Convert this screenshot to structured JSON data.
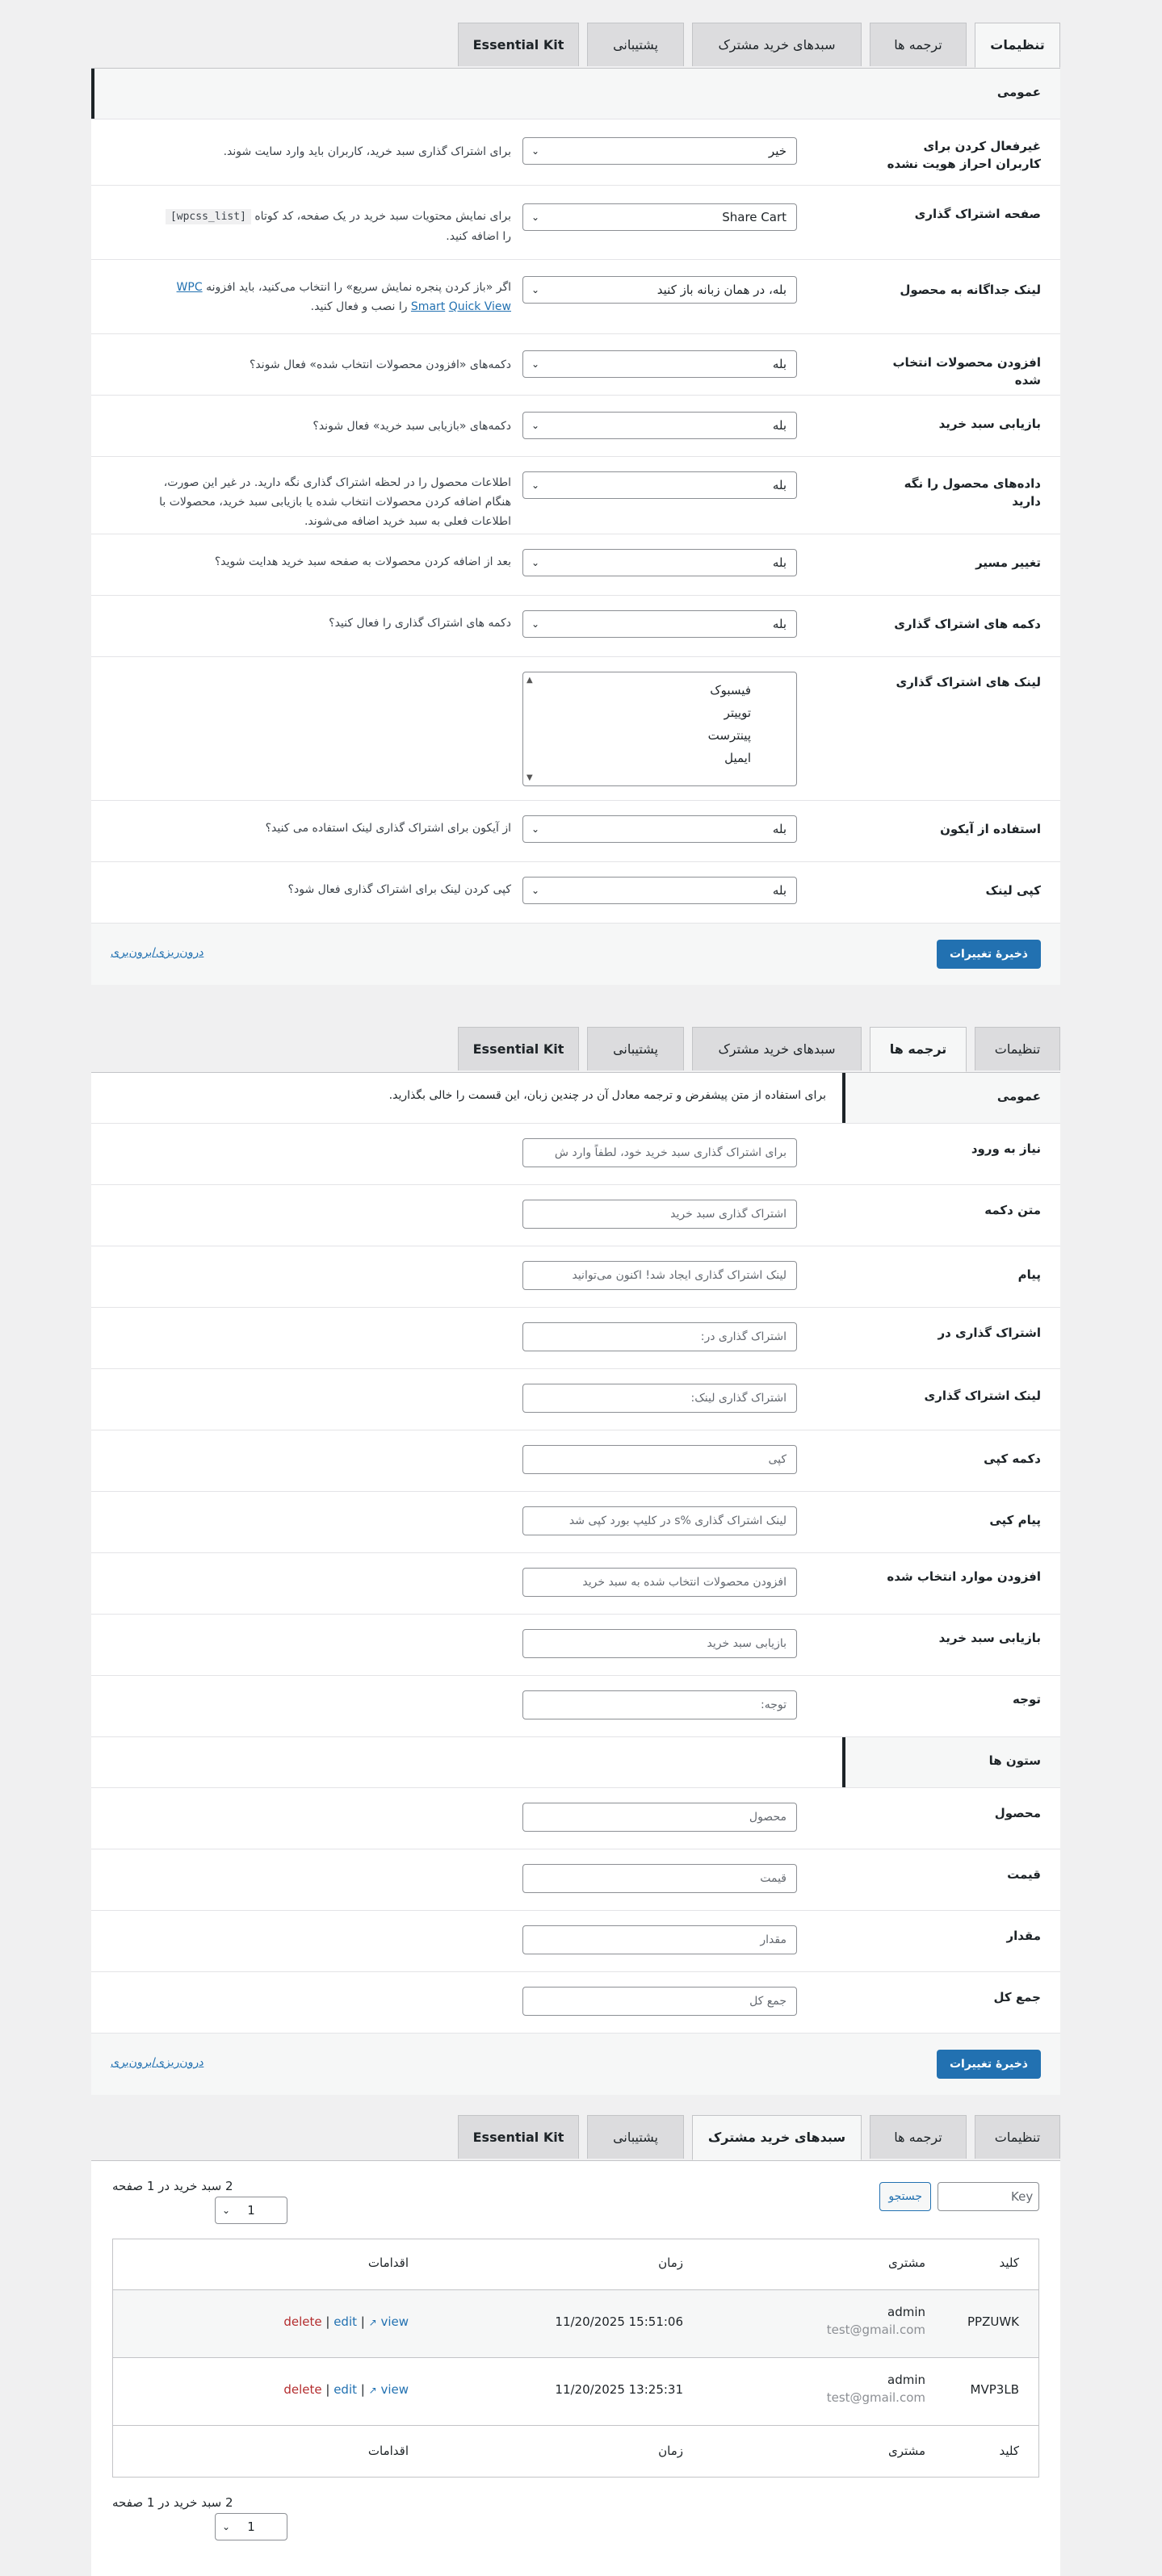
{
  "tabs": {
    "settings": "تنظیمات",
    "translations": "ترجمه ها",
    "shared_carts": "سبدهای خرید مشترک",
    "support": "پشتیبانی",
    "essential_kit": "Essential Kit"
  },
  "settings": {
    "section_general": "عمومی",
    "rows": [
      {
        "label": "غیرفعال کردن برای کاربران احراز هویت نشده",
        "value": "خیر",
        "desc": "برای اشتراک گذاری سبد خرید، کاربران باید وارد سایت شوند."
      },
      {
        "label": "صفحه اشتراک گذاری",
        "value": "Share Cart",
        "desc_pre": "برای نمایش محتویات سبد خرید در یک صفحه، کد کوتاه",
        "shortcode": "[wpcss_list]",
        "desc_post": "را اضافه کنید."
      },
      {
        "label": "لینک جداگانه به محصول",
        "value": "بله، در همان زبانه باز کنید",
        "desc_pre": "اگر «باز کردن پنجره نمایش سریع» را انتخاب می‌کنید، باید افزونه",
        "link1": "WPC Smart",
        "link2": "Quick View",
        "desc_post": "را نصب و فعال کنید."
      },
      {
        "label": "افزودن محصولات انتخاب شده",
        "value": "بله",
        "desc": "دکمه‌های «افزودن محصولات انتخاب شده» فعال شوند؟"
      },
      {
        "label": "بازیابی سبد خرید",
        "value": "بله",
        "desc": "دکمه‌های «بازیابی سبد خرید» فعال شوند؟"
      },
      {
        "label": "داده‌های محصول را نگه دارید",
        "value": "بله",
        "desc": "اطلاعات محصول را در لحظه اشتراک گذاری نگه دارید. در غیر این صورت، هنگام اضافه کردن محصولات انتخاب شده یا بازیابی سبد خرید، محصولات با اطلاعات فعلی به سبد خرید اضافه می‌شوند."
      },
      {
        "label": "تغییر مسیر",
        "value": "بله",
        "desc": "بعد از اضافه کردن محصولات به صفحه سبد خرید هدایت شوید؟"
      },
      {
        "label": "دکمه های اشتراک گذاری",
        "value": "بله",
        "desc": "دکمه های اشتراک گذاری را فعال کنید؟"
      }
    ],
    "share_links": {
      "label": "لینک های اشتراک گذاری",
      "options": [
        "فیسبوک",
        "توییتر",
        "پینترست",
        "ایمیل"
      ]
    },
    "rows2": [
      {
        "label": "استفاده از آیکون",
        "value": "بله",
        "desc": "از آیکون برای اشتراک گذاری لینک استفاده می کنید؟"
      },
      {
        "label": "کپی لینک",
        "value": "بله",
        "desc": "کپی کردن لینک برای اشتراک گذاری فعال شود؟"
      }
    ],
    "save": "ذخیرهٔ تغییرات",
    "import_export": "درون‌ریزی/برون‌بری"
  },
  "translations": {
    "section_general": "عمومی",
    "notice": "برای استفاده از متن پیشفرض و ترجمه معادل آن در چندین زبان، این قسمت را خالی بگذارید.",
    "rows": [
      {
        "label": "نیاز به ورود",
        "placeholder": "برای اشتراک گذاری سبد خرید خود، لطفاً وارد ش"
      },
      {
        "label": "متن دکمه",
        "placeholder": "اشتراک گذاری سبد خرید"
      },
      {
        "label": "پیام",
        "placeholder": "لینک اشتراک گذاری ایجاد شد! اکنون می‌توانید"
      },
      {
        "label": "اشتراک گذاری در",
        "placeholder": "اشتراک گذاری در:"
      },
      {
        "label": "لینک اشتراک گذاری",
        "placeholder": "اشتراک گذاری لینک:"
      },
      {
        "label": "دکمه کپی",
        "placeholder": "کپی"
      },
      {
        "label": "پیام کپی",
        "placeholder": "لینک اشتراک گذاری %s در کلیپ بورد کپی شد"
      },
      {
        "label": "افزودن موارد انتخاب شده",
        "placeholder": "افزودن محصولات انتخاب شده به سبد خرید"
      },
      {
        "label": "بازیابی سبد خرید",
        "placeholder": "بازیابی سبد خرید"
      },
      {
        "label": "توجه",
        "placeholder": "توجه:"
      }
    ],
    "section_columns": "ستون ها",
    "cols": [
      {
        "label": "محصول",
        "placeholder": "محصول"
      },
      {
        "label": "قیمت",
        "placeholder": "قیمت"
      },
      {
        "label": "مقدار",
        "placeholder": "مقدار"
      },
      {
        "label": "جمع کل",
        "placeholder": "جمع کل"
      }
    ],
    "save": "ذخیرهٔ تغییرات",
    "import_export": "درون‌ریزی/برون‌بری"
  },
  "shared": {
    "search_placeholder": "Key",
    "search_button": "جستجو",
    "pager_text": "2 سبد خرید در 1 صفحه",
    "page_value": "1",
    "headers": {
      "key": "کلید",
      "customer": "مشتری",
      "time": "زمان",
      "actions": "اقدامات"
    },
    "rows": [
      {
        "key": "PPZUWK",
        "user": "admin",
        "email": "test@gmail.com",
        "time": "11/20/2025 15:51:06",
        "view": "view",
        "edit": "edit",
        "delete": "delete"
      },
      {
        "key": "MVP3LB",
        "user": "admin",
        "email": "test@gmail.com",
        "time": "11/20/2025 13:25:31",
        "view": "view",
        "edit": "edit",
        "delete": "delete"
      }
    ]
  }
}
